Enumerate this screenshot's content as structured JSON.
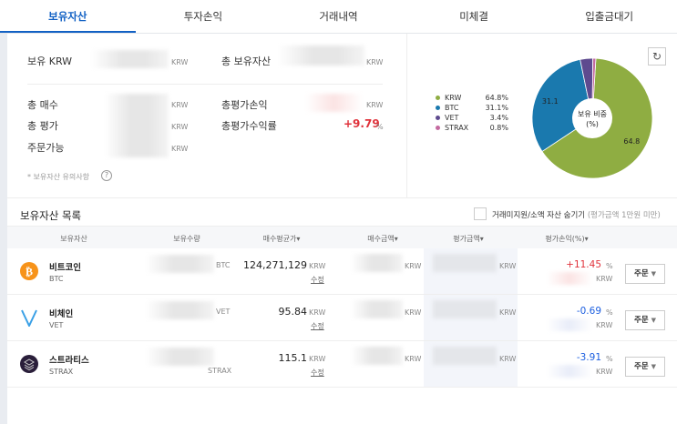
{
  "tabs": [
    "보유자산",
    "투자손익",
    "거래내역",
    "미체결",
    "입출금대기"
  ],
  "summary": {
    "krw_label": "보유 KRW",
    "total_assets_label": "총 보유자산",
    "total_buy_label": "총 매수",
    "total_eval_label": "총 평가",
    "orderable_label": "주문가능",
    "total_pl_label": "총평가손익",
    "total_rate_label": "총평가수익률",
    "total_rate_value": "+9.79",
    "percent": "%",
    "unit": "KRW",
    "notice": "* 보유자산 유의사항",
    "help_icon": "?"
  },
  "chart_data": {
    "type": "pie",
    "center_label": "보유 비중\n(%)",
    "center_line1": "보유 비중",
    "center_line2": "(%)",
    "slices": [
      {
        "name": "KRW",
        "value": 64.8,
        "label": "64.8%",
        "color": "#8fad42"
      },
      {
        "name": "BTC",
        "value": 31.1,
        "label": "31.1%",
        "color": "#1a79ae"
      },
      {
        "name": "VET",
        "value": 3.4,
        "label": "3.4%",
        "color": "#5e4a8f"
      },
      {
        "name": "STRAX",
        "value": 0.8,
        "label": "0.8%",
        "color": "#c46aa0"
      }
    ],
    "data_labels": [
      "64.8",
      "31.1"
    ]
  },
  "list": {
    "title": "보유자산 목록",
    "hide_label": "거래미지원/소액 자산 숨기기",
    "hide_note": "(평가금액 1만원 미만)",
    "headers": [
      "보유자산",
      "보유수량",
      "매수평균가▾",
      "매수금액▾",
      "평가금액▾",
      "평가손익(%)▾"
    ],
    "edit": "수정",
    "order": "주문",
    "unit": "KRW",
    "percent": "%",
    "rows": [
      {
        "name": "비트코인",
        "symbol": "BTC",
        "avg_price": "124,271,129",
        "rate": "+11.45",
        "color": "#e0313a"
      },
      {
        "name": "비체인",
        "symbol": "VET",
        "avg_price": "95.84",
        "rate": "-0.69",
        "color": "#1c5fe0"
      },
      {
        "name": "스트라티스",
        "symbol": "STRAX",
        "avg_price": "115.1",
        "rate": "-3.91",
        "color": "#1c5fe0"
      }
    ]
  }
}
